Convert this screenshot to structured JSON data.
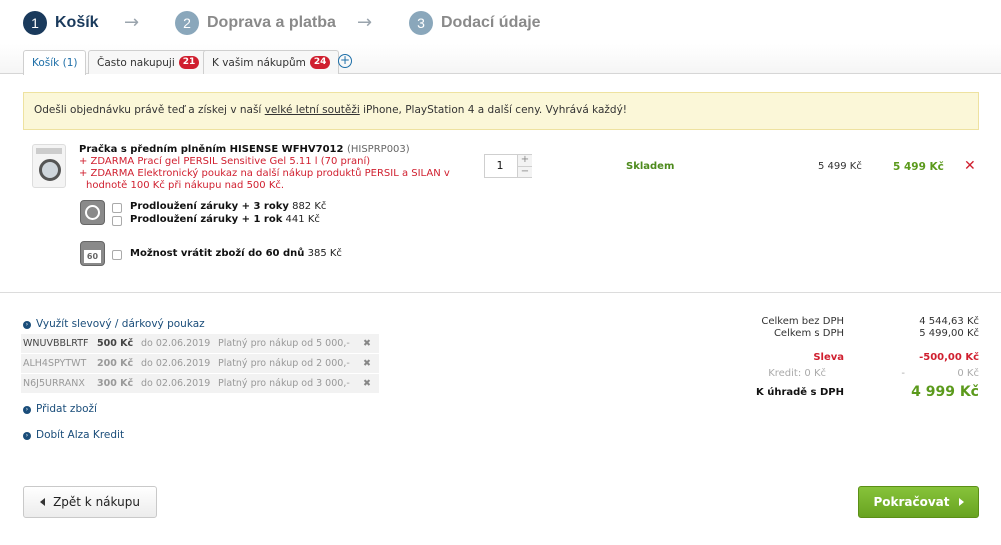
{
  "steps": [
    {
      "num": "1",
      "label": "Košík",
      "active": true
    },
    {
      "num": "2",
      "label": "Doprava a platba",
      "active": false
    },
    {
      "num": "3",
      "label": "Dodací údaje",
      "active": false
    }
  ],
  "step_arrow": "→",
  "tabs": [
    {
      "label": "Košík (1)",
      "badge": ""
    },
    {
      "label": "Často nakupuji",
      "badge": "21"
    },
    {
      "label": "K vašim nákupům",
      "badge": "24"
    }
  ],
  "tab_add": "+",
  "banner": {
    "before": "Odešli objednávku právě teď a získej v naší ",
    "link": "velké letní soutěži",
    "after": " iPhone, PlayStation 4 a další ceny. Vyhrává každý!"
  },
  "product": {
    "name": "Pračka s předním plněním HISENSE WFHV7012",
    "code": "(HISPRP003)",
    "gift1": "+ ZDARMA Prací gel PERSIL Sensitive Gel 5.11 l (70 praní)",
    "gift2a": "+ ZDARMA Elektronický poukaz na další nákup produktů PERSIL a SILAN v",
    "gift2b": "hodnotě 100 Kč při nákupu nad 500 Kč.",
    "quantity": "1",
    "qty_plus": "+",
    "qty_minus": "−",
    "stock": "Skladem",
    "unit_price": "5 499 Kč",
    "total_price": "5 499 Kč",
    "remove": "✕"
  },
  "services": [
    {
      "label": "Prodloužení záruky + 3 roky",
      "price": "882 Kč"
    },
    {
      "label": "Prodloužení záruky + 1 rok",
      "price": "441 Kč"
    },
    {
      "label": "Možnost vrátit zboží do 60 dnů",
      "price": "385 Kč"
    }
  ],
  "return_icon_text": "60",
  "links": {
    "voucher": "Využít slevový / dárkový poukaz",
    "add_goods": "Přidat zboží",
    "credit": "Dobít Alza Kredit",
    "arrow": "›"
  },
  "vouchers": [
    {
      "code": "WNUVBBLRTF",
      "amount": "500 Kč",
      "valid": "do 02.06.2019",
      "condition": "Platný pro nákup od 5 000,-",
      "remove": "✖"
    },
    {
      "code": "ALH4SPYTWT",
      "amount": "200 Kč",
      "valid": "do 02.06.2019",
      "condition": "Platný pro nákup od 2 000,-",
      "remove": "✖"
    },
    {
      "code": "N6J5URRANX",
      "amount": "300 Kč",
      "valid": "do 02.06.2019",
      "condition": "Platný pro nákup od 3 000,-",
      "remove": "✖"
    }
  ],
  "summary": {
    "no_vat_label": "Celkem bez DPH",
    "no_vat_value": "4 544,63 Kč",
    "vat_label": "Celkem s DPH",
    "vat_value": "5 499,00 Kč",
    "discount_label": "Sleva",
    "discount_value": "-500,00 Kč",
    "credit_label": "Kredit: 0 Kč",
    "credit_dash": "-",
    "credit_value": "0 Kč",
    "total_label": "K úhradě s DPH",
    "total_value": "4 999 Kč"
  },
  "buttons": {
    "back": "Zpět k nákupu",
    "next": "Pokračovat"
  },
  "colors": {
    "primary_navy": "#1a3a5c",
    "accent_green": "#5b9a1c",
    "alert_red": "#d01f2f",
    "banner_bg": "#fbf7d8"
  }
}
